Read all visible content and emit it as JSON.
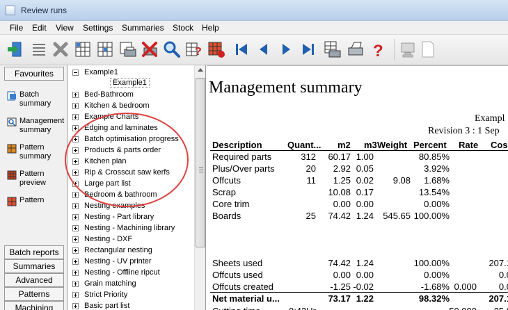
{
  "window": {
    "title": "Review runs"
  },
  "menu": [
    "File",
    "Edit",
    "View",
    "Settings",
    "Summaries",
    "Stock",
    "Help"
  ],
  "toolbar_icons": [
    "exit-icon",
    "list-icon",
    "delete-icon",
    "batch-grid-icon",
    "pattern-grid-icon",
    "print-batch-icon",
    "cancel-print-icon",
    "search-icon",
    "help-table-icon",
    "pattern-export-icon",
    "first-page-icon",
    "previous-page-icon",
    "next-page-icon",
    "last-page-icon",
    "print-preview-icon",
    "printer-icon",
    "question-icon",
    "computer-icon",
    "page-icon"
  ],
  "left_pane": {
    "header": "Favourites",
    "favourites": [
      "Batch summary",
      "Management summary",
      "Pattern summary",
      "Pattern preview",
      "Pattern"
    ],
    "nav_buttons": [
      "Batch reports",
      "Summaries",
      "Advanced",
      "Patterns",
      "Machining"
    ]
  },
  "tree": {
    "items": [
      "Example1",
      "Bed-Bathroom",
      "Kitchen & bedroom",
      "Example Charts",
      "Edging and laminates",
      "Batch optimisation progress",
      "Products & parts order",
      "Kitchen plan",
      "Rip & Crosscut saw kerfs",
      "Large part list",
      "Bedroom & bathroom",
      "Nesting examples",
      "Nesting - Part library",
      "Nesting - Machining library",
      "Nesting - DXF",
      "Rectangular nesting",
      "Nesting - UV printer",
      "Nesting - Offline ripcut",
      "Grain matching",
      "Strict Priority",
      "Basic part list"
    ],
    "child": "Example1",
    "highlight_color": "#e04040"
  },
  "report": {
    "title": "Management summary",
    "subtitle1": "Exampl",
    "subtitle2": "Revision 3 : 1 Sep",
    "columns": [
      "Description",
      "Quant...",
      "m2",
      "m3",
      "Weight",
      "Percent",
      "Rate",
      "Cos"
    ],
    "rows": [
      [
        "Required parts",
        "312",
        "60.17",
        "1.00",
        "",
        "80.85%",
        "",
        ""
      ],
      [
        "Plus/Over parts",
        "20",
        "2.92",
        "0.05",
        "",
        "3.92%",
        "",
        ""
      ],
      [
        "Offcuts",
        "11",
        "1.25",
        "0.02",
        "9.08",
        "1.68%",
        "",
        ""
      ],
      [
        "Scrap",
        "",
        "10.08",
        "0.17",
        "",
        "13.54%",
        "",
        ""
      ],
      [
        "Core trim",
        "",
        "0.00",
        "0.00",
        "",
        "0.00%",
        "",
        ""
      ],
      [
        "Boards",
        "25",
        "74.42",
        "1.24",
        "545.65",
        "100.00%",
        "",
        ""
      ]
    ],
    "rows2": [
      [
        "Sheets used",
        "",
        "74.42",
        "1.24",
        "",
        "100.00%",
        "",
        "207.1"
      ],
      [
        "Offcuts used",
        "",
        "0.00",
        "0.00",
        "",
        "0.00%",
        "",
        "0.0"
      ],
      [
        "Offcuts created",
        "",
        "-1.25",
        "-0.02",
        "",
        "-1.68%",
        "0.000",
        "0.0"
      ]
    ],
    "total": [
      "Net material u...",
      "",
      "73.17",
      "1.22",
      "",
      "98.32%",
      "",
      "207.1"
    ],
    "cut_row": [
      "Cutting time",
      "0:43Hr",
      "",
      "",
      "",
      "",
      "50.000",
      "35.8"
    ]
  }
}
